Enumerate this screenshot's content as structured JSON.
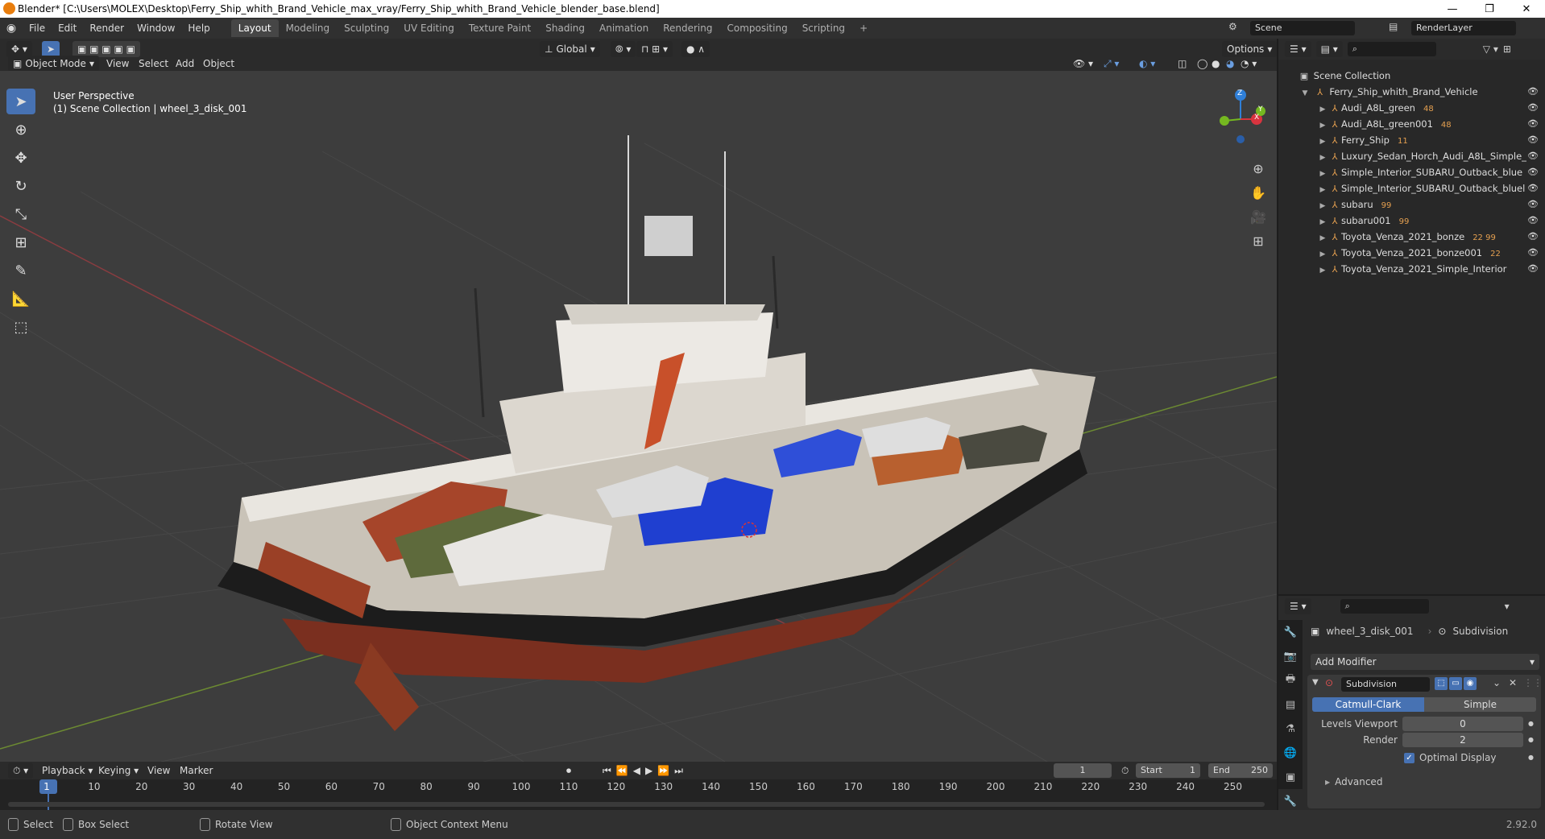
{
  "window": {
    "title": "Blender* [C:\\Users\\MOLEX\\Desktop\\Ferry_Ship_whith_Brand_Vehicle_max_vray/Ferry_Ship_whith_Brand_Vehicle_blender_base.blend]",
    "minimize": "—",
    "maximize": "❐",
    "close": "✕"
  },
  "menus": [
    "File",
    "Edit",
    "Render",
    "Window",
    "Help"
  ],
  "workspaces": [
    "Layout",
    "Modeling",
    "Sculpting",
    "UV Editing",
    "Texture Paint",
    "Shading",
    "Animation",
    "Rendering",
    "Compositing",
    "Scripting"
  ],
  "add_workspace": "+",
  "scene": {
    "name": "Scene",
    "render_layer": "RenderLayer"
  },
  "viewport_header": {
    "transform_orientation": "Global",
    "options": "Options",
    "mode": "Object Mode",
    "menus": [
      "View",
      "Select",
      "Add",
      "Object"
    ]
  },
  "viewport": {
    "perspective": "User Perspective",
    "collection_info": "(1) Scene Collection | wheel_3_disk_001"
  },
  "gizmo": {
    "z": "Z",
    "x": "X",
    "y": "Y"
  },
  "outliner": {
    "root": "Scene Collection",
    "collection": "Ferry_Ship_whith_Brand_Vehicle",
    "items": [
      {
        "name": "Audi_A8L_green",
        "badge": "48"
      },
      {
        "name": "Audi_A8L_green001",
        "badge": "48"
      },
      {
        "name": "Ferry_Ship",
        "badge": "11"
      },
      {
        "name": "Luxury_Sedan_Horch_Audi_A8L_Simple_",
        "badge": ""
      },
      {
        "name": "Simple_Interior_SUBARU_Outback_blue",
        "badge": ""
      },
      {
        "name": "Simple_Interior_SUBARU_Outback_bluel",
        "badge": ""
      },
      {
        "name": "subaru",
        "badge": "99"
      },
      {
        "name": "subaru001",
        "badge": "99"
      },
      {
        "name": "Toyota_Venza_2021_bonze",
        "badge": "22 99"
      },
      {
        "name": "Toyota_Venza_2021_bonze001",
        "badge": "22"
      },
      {
        "name": "Toyota_Venza_2021_Simple_Interior",
        "badge": ""
      }
    ]
  },
  "properties": {
    "object": "wheel_3_disk_001",
    "modifier_context": "Subdivision",
    "add_modifier": "Add Modifier",
    "modifier_name": "Subdivision",
    "algo_catmull": "Catmull-Clark",
    "algo_simple": "Simple",
    "levels_viewport_label": "Levels Viewport",
    "levels_viewport": "0",
    "render_label": "Render",
    "render_value": "2",
    "optimal_display": "Optimal Display",
    "advanced": "Advanced"
  },
  "timeline": {
    "menus": [
      "Playback",
      "Keying",
      "View",
      "Marker"
    ],
    "current_frame": "1",
    "start_label": "Start",
    "start": "1",
    "end_label": "End",
    "end": "250",
    "ticks": [
      "1",
      "10",
      "20",
      "30",
      "40",
      "50",
      "60",
      "70",
      "80",
      "90",
      "100",
      "110",
      "120",
      "130",
      "140",
      "150",
      "160",
      "170",
      "180",
      "190",
      "200",
      "210",
      "220",
      "230",
      "240",
      "250"
    ]
  },
  "statusbar": {
    "select": "Select",
    "box_select": "Box Select",
    "rotate_view": "Rotate View",
    "context_menu": "Object Context Menu",
    "version": "2.92.0"
  }
}
